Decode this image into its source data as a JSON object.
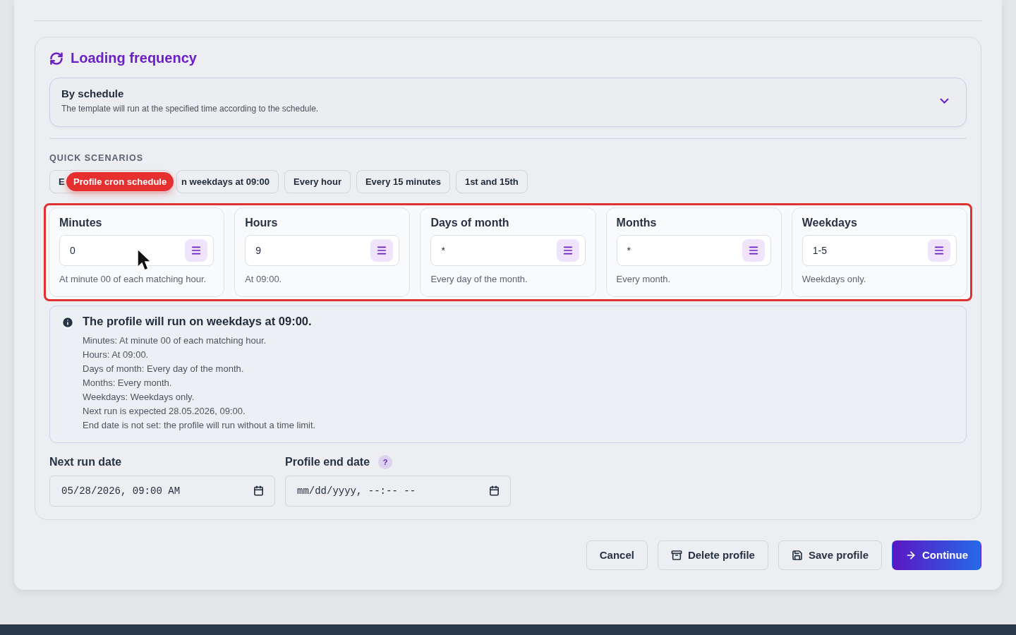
{
  "section": {
    "title": "Loading frequency"
  },
  "mode_select": {
    "title": "By schedule",
    "description": "The template will run at the specified time according to the schedule."
  },
  "quick_scenarios": {
    "heading": "QUICK SCENARIOS",
    "badge": "Profile cron schedule",
    "chips": [
      {
        "label": "E"
      },
      {
        "label": "n weekdays at 09:00"
      },
      {
        "label": "Every hour"
      },
      {
        "label": "Every 15 minutes"
      },
      {
        "label": "1st and 15th"
      }
    ]
  },
  "cron_fields": [
    {
      "title": "Minutes",
      "value": "0",
      "description": "At minute 00 of each matching hour."
    },
    {
      "title": "Hours",
      "value": "9",
      "description": "At 09:00."
    },
    {
      "title": "Days of month",
      "value": "*",
      "description": "Every day of the month."
    },
    {
      "title": "Months",
      "value": "*",
      "description": "Every month."
    },
    {
      "title": "Weekdays",
      "value": "1-5",
      "description": "Weekdays only."
    }
  ],
  "summary": {
    "title": "The profile will run on weekdays at 09:00.",
    "lines": [
      "Minutes: At minute 00 of each matching hour.",
      "Hours: At 09:00.",
      "Days of month: Every day of the month.",
      "Months: Every month.",
      "Weekdays: Weekdays only.",
      "Next run is expected 28.05.2026, 09:00.",
      "End date is not set: the profile will run without a time limit."
    ]
  },
  "dates": [
    {
      "label": "Next run date",
      "value": "05/28/2026, 09:00 AM"
    },
    {
      "label": "Profile end date",
      "help": "?",
      "placeholder": "mm/dd/yyyy, --:-- --"
    }
  ],
  "actions": [
    {
      "kind": "plain",
      "label": "Cancel"
    },
    {
      "kind": "delete",
      "label": "Delete profile"
    },
    {
      "kind": "save",
      "label": "Save profile"
    },
    {
      "kind": "primary",
      "label": "Continue"
    }
  ]
}
